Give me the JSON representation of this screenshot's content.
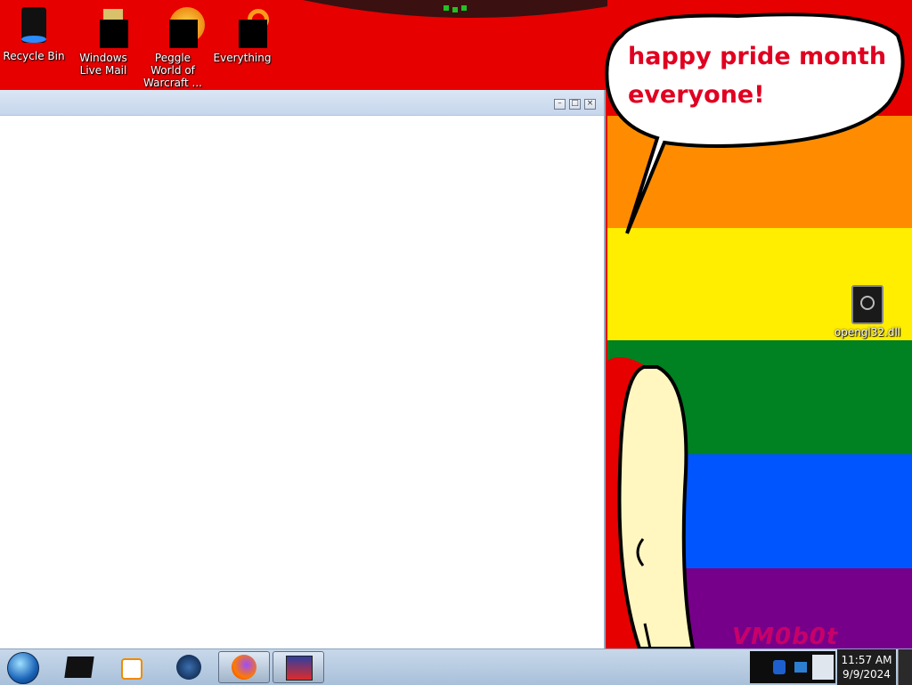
{
  "desktop": {
    "icons": [
      {
        "label": "Recycle Bin",
        "icon": "recycle-bin-icon"
      },
      {
        "label": "Windows Live Mail",
        "icon": "mail-icon"
      },
      {
        "label": "Peggle World of Warcraft ...",
        "icon": "peggle-icon"
      },
      {
        "label": "Everything",
        "icon": "search-icon"
      },
      {
        "label": "opengl32.dll",
        "icon": "dll-file-icon"
      }
    ]
  },
  "wallpaper": {
    "bubble_text": "happy pride month everyone!",
    "logo_text": "VM0b0t",
    "colors": {
      "red": "#e60000",
      "orange": "#ff8c00",
      "yellow": "#ffee00",
      "green": "#008122",
      "blue": "#0055ff",
      "purple": "#760089"
    }
  },
  "window": {
    "buttons": {
      "minimize": "–",
      "maximize": "□",
      "close": "×"
    }
  },
  "taskbar": {
    "start": "start-orb-icon",
    "items": [
      {
        "icon": "terminal-icon",
        "active": false
      },
      {
        "icon": "media-player-icon",
        "active": false
      },
      {
        "icon": "globe-icon",
        "active": false
      },
      {
        "icon": "firefox-icon",
        "active": true
      },
      {
        "icon": "app-window-icon",
        "active": true
      }
    ],
    "clock": {
      "time": "11:57 AM",
      "date": "9/9/2024"
    }
  }
}
